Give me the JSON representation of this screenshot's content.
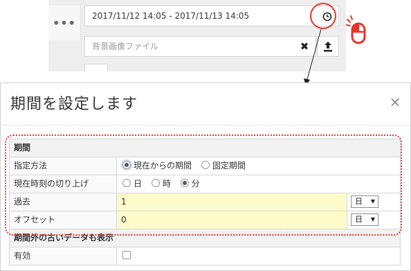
{
  "snippet": {
    "more_label": "•••",
    "period_value": "2017/11/12 14:05 - 2017/11/13 14:05",
    "background_placeholder": "背景画像ファイル",
    "clear_symbol": "✖",
    "icons": [
      "more-icon",
      "clock-icon",
      "clear-icon",
      "upload-icon",
      "mouse-icon"
    ]
  },
  "dialog": {
    "title": "期間を設定します",
    "close_symbol": "×",
    "section_period": "期間",
    "rows": {
      "method": {
        "label": "指定方法",
        "options": [
          "現在からの期間",
          "固定期間"
        ],
        "selected": "現在からの期間"
      },
      "roundup": {
        "label": "現在時刻の切り上げ",
        "options": [
          "日",
          "時",
          "分"
        ],
        "selected": "分"
      },
      "past": {
        "label": "過去",
        "value": "1",
        "unit": "日"
      },
      "offset": {
        "label": "オフセット",
        "value": "0",
        "unit": "日"
      }
    },
    "section_old_data": "期間外の古いデータも表示",
    "enabled": {
      "label": "有効",
      "checked": false
    }
  },
  "colors": {
    "highlight_red": "#e8332a",
    "input_yellow": "#fdfbc9"
  }
}
